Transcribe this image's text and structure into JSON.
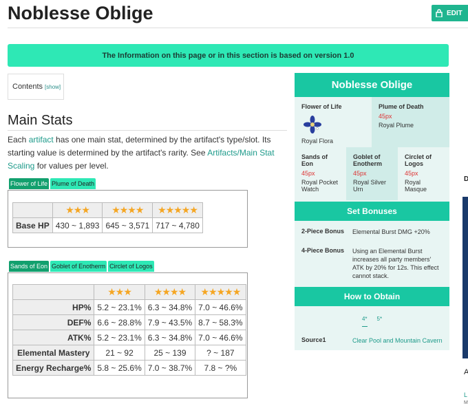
{
  "page": {
    "title": "Noblesse Oblige",
    "edit_label": "EDIT"
  },
  "banner": {
    "text": "The Information on this page or in this section is based on version 1.0"
  },
  "toc": {
    "label": "Contents",
    "show": "[show]"
  },
  "main_stats": {
    "heading": "Main Stats",
    "para_1": "Each ",
    "link_artifact": "artifact",
    "para_2": " has one main stat, determined by the artifact's type/slot. Its starting value is determined by the artifact's rarity. See ",
    "link_scaling": "Artifacts/Main Stat Scaling",
    "para_3": " for values per level."
  },
  "table1": {
    "tabs": [
      "Flower of Life",
      "Plume of Death"
    ],
    "active_tab": 0,
    "stars": [
      "★★★",
      "★★★★",
      "★★★★★"
    ],
    "rows": [
      {
        "label": "Base HP",
        "values": [
          "430 ~ 1,893",
          "645 ~ 3,571",
          "717 ~ 4,780"
        ]
      }
    ]
  },
  "table2": {
    "tabs": [
      "Sands of Eon",
      "Goblet of Enotherm",
      "Circlet of Logos"
    ],
    "active_tab": 0,
    "stars": [
      "★★★",
      "★★★★",
      "★★★★★"
    ],
    "rows": [
      {
        "label": "HP%",
        "values": [
          "5.2 ~ 23.1%",
          "6.3 ~ 34.8%",
          "7.0 ~ 46.6%"
        ]
      },
      {
        "label": "DEF%",
        "values": [
          "6.6 ~ 28.8%",
          "7.9 ~ 43.5%",
          "8.7 ~ 58.3%"
        ]
      },
      {
        "label": "ATK%",
        "values": [
          "5.2 ~ 23.1%",
          "6.3 ~ 34.8%",
          "7.0 ~ 46.6%"
        ]
      },
      {
        "label": "Elemental Mastery",
        "values": [
          "21 ~ 92",
          "25 ~ 139",
          "? ~ 187"
        ]
      },
      {
        "label": "Energy Recharge%",
        "values": [
          "5.8 ~ 25.6%",
          "7.0 ~ 38.7%",
          "7.8 ~ ?%"
        ]
      }
    ]
  },
  "infobox": {
    "title": "Noblesse Oblige",
    "flower": {
      "label": "Flower of Life",
      "value": "Royal Flora"
    },
    "plume": {
      "label": "Plume of Death",
      "px": "45px",
      "value": "Royal Plume"
    },
    "sands": {
      "label": "Sands of Eon",
      "px": "45px",
      "value": "Royal Pocket Watch"
    },
    "goblet": {
      "label": "Goblet of Enotherm",
      "px": "45px",
      "value": "Royal Silver Urn"
    },
    "circlet": {
      "label": "Circlet of Logos",
      "px": "45px",
      "value": "Royal Masque"
    },
    "set_bonuses_heading": "Set Bonuses",
    "bonus2_label": "2-Piece Bonus",
    "bonus2_text": "Elemental Burst DMG +20%",
    "bonus4_label": "4-Piece Bonus",
    "bonus4_text": "Using an Elemental Burst increases all party members' ATK by 20% for 12s. This effect cannot stack.",
    "obtain_heading": "How to Obtain",
    "obtain_tabs": [
      "4*",
      "5*"
    ],
    "source_label": "Source1",
    "source_value": "Clear Pool and Mountain Cavern"
  },
  "right_edge": {
    "d": "D",
    "glyph": "A",
    "l": "L",
    "m": "M"
  },
  "colors": {
    "accent": "#19c7a2",
    "banner": "#2ee8b5",
    "edit": "#1fb58f",
    "link": "#1d9a8a",
    "star": "#f5a623"
  }
}
